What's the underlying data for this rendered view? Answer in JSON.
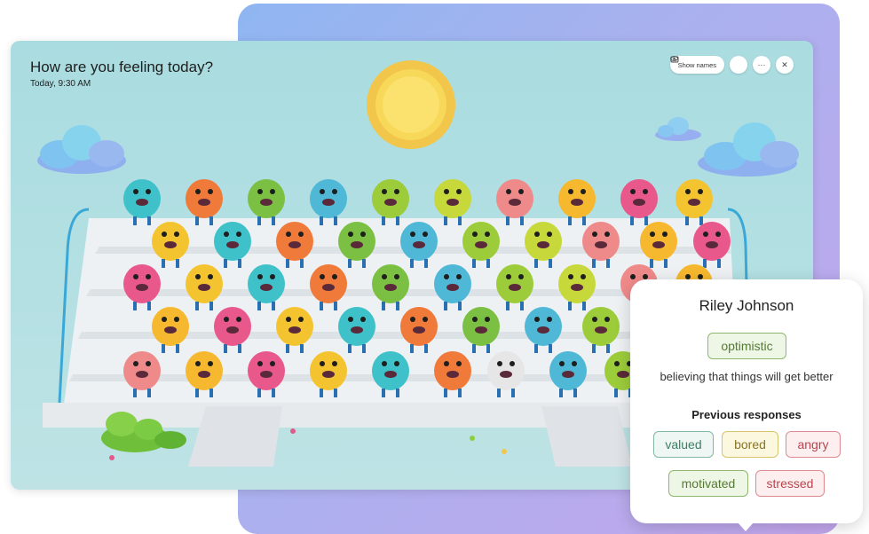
{
  "app": {
    "title": "How are you feeling today?",
    "subtitle": "Today, 9:30 AM"
  },
  "toolbar": {
    "show_names_label": "Show names",
    "show_names_icon": "eye-icon",
    "present_icon": "present-icon",
    "more_icon": "more-icon",
    "close_icon": "close-icon"
  },
  "popup": {
    "name": "Riley Johnson",
    "emotion": "optimistic",
    "definition": "believing that things will get better",
    "previous_heading": "Previous responses",
    "previous": [
      "valued",
      "bored",
      "angry",
      "motivated",
      "stressed"
    ]
  },
  "colors": {
    "accent_gradient_start": "#8fb6f2",
    "accent_gradient_end": "#c3a6ec",
    "scene_background": "#b4e0e3"
  }
}
